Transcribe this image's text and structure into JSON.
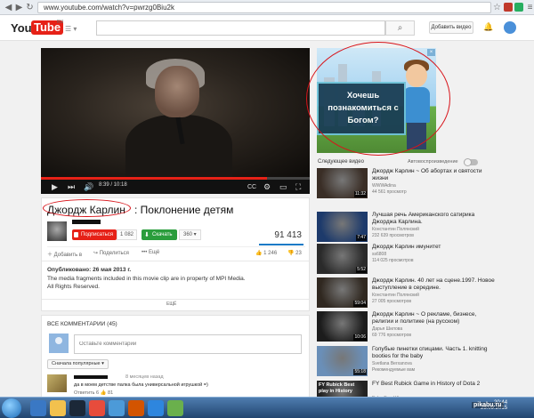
{
  "browser": {
    "url": "www.youtube.com/watch?v=pwrzg0Biu2k"
  },
  "header": {
    "logo_you": "You",
    "logo_tube": "Tube",
    "logo_region": "RU",
    "upload_label": "Добавить видео"
  },
  "player": {
    "time": "8:39 / 10:18",
    "progress": 0.84
  },
  "ad": {
    "text": "Хочешь познакомиться с Богом?"
  },
  "video": {
    "title_author": "Джордж Карлин",
    "title_rest": ": Поклонение детям",
    "subscribe_label": "Подписаться",
    "subscriber_count": "1 082",
    "download_label": "Скачать",
    "download_size": "360",
    "views": "91 413",
    "actions": [
      "Добавить в",
      "Поделиться",
      "Ещё"
    ],
    "likes": "1 246",
    "dislikes": "23",
    "published": "Опубликовано: 26 мая 2013 г.",
    "description_1": "The media fragments included in this movie clip are in property of MPI Media.",
    "description_2": "All Rights Reserved.",
    "more_label": "ЕЩЁ"
  },
  "comments": {
    "header": "ВСЕ КОММЕНТАРИИ (45)",
    "input_placeholder": "Оставьте комментарий",
    "sort_label": "Сначала популярные",
    "first": {
      "time": "8 месяцев назад",
      "text": "да в моем детстве палка была универсальной игрушкой =)",
      "reply_label": "Ответить",
      "likes": "6",
      "dislikes": "81"
    }
  },
  "sidebar": {
    "next_label": "Следующее видео",
    "autoplay_label": "Автовоспроизведение",
    "items": [
      {
        "title": "Джордж Карлин ~ Об абортах и святости жизни",
        "channel": "WWWAdina",
        "views": "44 561 просмотр",
        "duration": "11:32",
        "color": "#3a2e26"
      },
      {
        "title": "Лучшая речь Американского сатирика Джорджа Карлина.",
        "channel": "Константин Полянский",
        "views": "232 639 просмотров",
        "duration": "7:47",
        "color": "#1d3a6b"
      },
      {
        "title": "Джордж Карлин имунитет",
        "channel": "ss6808",
        "views": "114 025 просмотров",
        "duration": "5:52",
        "color": "#2a2a2a"
      },
      {
        "title": "Джордж Карлин. 40 лет на сцене.1997. Новое выступление в середине.",
        "channel": "Константин Полянский",
        "views": "27 005 просмотров",
        "duration": "59:04",
        "color": "#302820"
      },
      {
        "title": "Джордж Карлин ~ О рекламе, бизнесе, религии и политике (на русском)",
        "channel": "Дарья Шилова",
        "views": "69 776 просмотров",
        "duration": "10:06",
        "color": "#1c1c1c"
      },
      {
        "title": "Голубые пинетки спицами. Часть 1. knitting booties for the baby",
        "channel": "Svetlana Berxanova",
        "views": "Рекомендуемые вам",
        "duration": "55:18",
        "color": "#6a8fb8"
      },
      {
        "title": "FY Best Rubick Game in History of Dota 2",
        "channel": "BoborEmuUA",
        "views": "Рекомендуемые вам",
        "duration": "",
        "color": "#222222",
        "thumb_text": "FY Rubick Best play in History"
      }
    ]
  },
  "taskbar": {
    "time": "20:44",
    "date": "25.09.2015"
  },
  "watermark": "pikabu.ru"
}
